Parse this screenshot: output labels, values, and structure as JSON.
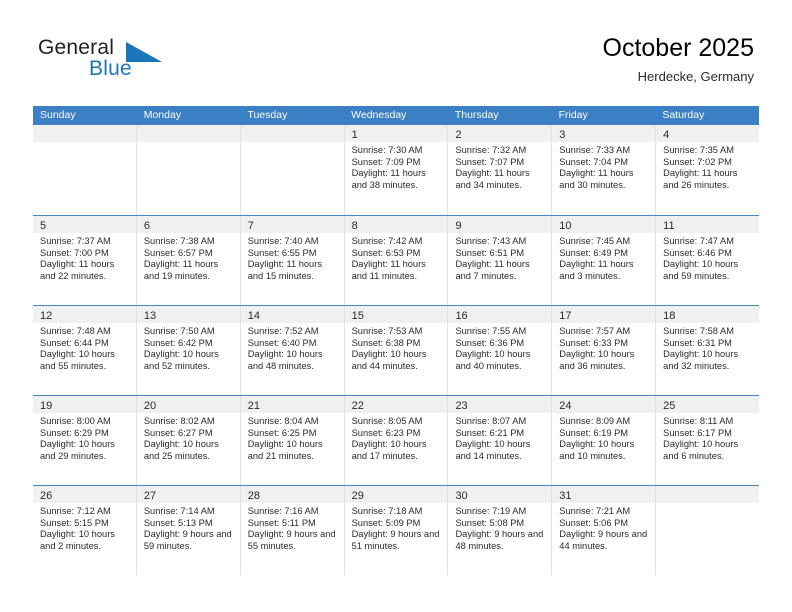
{
  "brand": {
    "word_general": "General",
    "word_blue": "Blue",
    "accent_color": "#1b75bb"
  },
  "header": {
    "title": "October 2025",
    "subtitle": "Herdecke, Germany",
    "header_bg_color": "#3b7fc4"
  },
  "weekdays": [
    "Sunday",
    "Monday",
    "Tuesday",
    "Wednesday",
    "Thursday",
    "Friday",
    "Saturday"
  ],
  "labels": {
    "sunrise_prefix": "Sunrise:",
    "sunset_prefix": "Sunset:",
    "daylight_prefix": "Daylight:"
  },
  "weeks": [
    [
      {
        "day": ""
      },
      {
        "day": ""
      },
      {
        "day": ""
      },
      {
        "day": "1",
        "sunrise": "Sunrise: 7:30 AM",
        "sunset": "Sunset: 7:09 PM",
        "daylight": "Daylight: 11 hours and 38 minutes."
      },
      {
        "day": "2",
        "sunrise": "Sunrise: 7:32 AM",
        "sunset": "Sunset: 7:07 PM",
        "daylight": "Daylight: 11 hours and 34 minutes."
      },
      {
        "day": "3",
        "sunrise": "Sunrise: 7:33 AM",
        "sunset": "Sunset: 7:04 PM",
        "daylight": "Daylight: 11 hours and 30 minutes."
      },
      {
        "day": "4",
        "sunrise": "Sunrise: 7:35 AM",
        "sunset": "Sunset: 7:02 PM",
        "daylight": "Daylight: 11 hours and 26 minutes."
      }
    ],
    [
      {
        "day": "5",
        "sunrise": "Sunrise: 7:37 AM",
        "sunset": "Sunset: 7:00 PM",
        "daylight": "Daylight: 11 hours and 22 minutes."
      },
      {
        "day": "6",
        "sunrise": "Sunrise: 7:38 AM",
        "sunset": "Sunset: 6:57 PM",
        "daylight": "Daylight: 11 hours and 19 minutes."
      },
      {
        "day": "7",
        "sunrise": "Sunrise: 7:40 AM",
        "sunset": "Sunset: 6:55 PM",
        "daylight": "Daylight: 11 hours and 15 minutes."
      },
      {
        "day": "8",
        "sunrise": "Sunrise: 7:42 AM",
        "sunset": "Sunset: 6:53 PM",
        "daylight": "Daylight: 11 hours and 11 minutes."
      },
      {
        "day": "9",
        "sunrise": "Sunrise: 7:43 AM",
        "sunset": "Sunset: 6:51 PM",
        "daylight": "Daylight: 11 hours and 7 minutes."
      },
      {
        "day": "10",
        "sunrise": "Sunrise: 7:45 AM",
        "sunset": "Sunset: 6:49 PM",
        "daylight": "Daylight: 11 hours and 3 minutes."
      },
      {
        "day": "11",
        "sunrise": "Sunrise: 7:47 AM",
        "sunset": "Sunset: 6:46 PM",
        "daylight": "Daylight: 10 hours and 59 minutes."
      }
    ],
    [
      {
        "day": "12",
        "sunrise": "Sunrise: 7:48 AM",
        "sunset": "Sunset: 6:44 PM",
        "daylight": "Daylight: 10 hours and 55 minutes."
      },
      {
        "day": "13",
        "sunrise": "Sunrise: 7:50 AM",
        "sunset": "Sunset: 6:42 PM",
        "daylight": "Daylight: 10 hours and 52 minutes."
      },
      {
        "day": "14",
        "sunrise": "Sunrise: 7:52 AM",
        "sunset": "Sunset: 6:40 PM",
        "daylight": "Daylight: 10 hours and 48 minutes."
      },
      {
        "day": "15",
        "sunrise": "Sunrise: 7:53 AM",
        "sunset": "Sunset: 6:38 PM",
        "daylight": "Daylight: 10 hours and 44 minutes."
      },
      {
        "day": "16",
        "sunrise": "Sunrise: 7:55 AM",
        "sunset": "Sunset: 6:36 PM",
        "daylight": "Daylight: 10 hours and 40 minutes."
      },
      {
        "day": "17",
        "sunrise": "Sunrise: 7:57 AM",
        "sunset": "Sunset: 6:33 PM",
        "daylight": "Daylight: 10 hours and 36 minutes."
      },
      {
        "day": "18",
        "sunrise": "Sunrise: 7:58 AM",
        "sunset": "Sunset: 6:31 PM",
        "daylight": "Daylight: 10 hours and 32 minutes."
      }
    ],
    [
      {
        "day": "19",
        "sunrise": "Sunrise: 8:00 AM",
        "sunset": "Sunset: 6:29 PM",
        "daylight": "Daylight: 10 hours and 29 minutes."
      },
      {
        "day": "20",
        "sunrise": "Sunrise: 8:02 AM",
        "sunset": "Sunset: 6:27 PM",
        "daylight": "Daylight: 10 hours and 25 minutes."
      },
      {
        "day": "21",
        "sunrise": "Sunrise: 8:04 AM",
        "sunset": "Sunset: 6:25 PM",
        "daylight": "Daylight: 10 hours and 21 minutes."
      },
      {
        "day": "22",
        "sunrise": "Sunrise: 8:05 AM",
        "sunset": "Sunset: 6:23 PM",
        "daylight": "Daylight: 10 hours and 17 minutes."
      },
      {
        "day": "23",
        "sunrise": "Sunrise: 8:07 AM",
        "sunset": "Sunset: 6:21 PM",
        "daylight": "Daylight: 10 hours and 14 minutes."
      },
      {
        "day": "24",
        "sunrise": "Sunrise: 8:09 AM",
        "sunset": "Sunset: 6:19 PM",
        "daylight": "Daylight: 10 hours and 10 minutes."
      },
      {
        "day": "25",
        "sunrise": "Sunrise: 8:11 AM",
        "sunset": "Sunset: 6:17 PM",
        "daylight": "Daylight: 10 hours and 6 minutes."
      }
    ],
    [
      {
        "day": "26",
        "sunrise": "Sunrise: 7:12 AM",
        "sunset": "Sunset: 5:15 PM",
        "daylight": "Daylight: 10 hours and 2 minutes."
      },
      {
        "day": "27",
        "sunrise": "Sunrise: 7:14 AM",
        "sunset": "Sunset: 5:13 PM",
        "daylight": "Daylight: 9 hours and 59 minutes."
      },
      {
        "day": "28",
        "sunrise": "Sunrise: 7:16 AM",
        "sunset": "Sunset: 5:11 PM",
        "daylight": "Daylight: 9 hours and 55 minutes."
      },
      {
        "day": "29",
        "sunrise": "Sunrise: 7:18 AM",
        "sunset": "Sunset: 5:09 PM",
        "daylight": "Daylight: 9 hours and 51 minutes."
      },
      {
        "day": "30",
        "sunrise": "Sunrise: 7:19 AM",
        "sunset": "Sunset: 5:08 PM",
        "daylight": "Daylight: 9 hours and 48 minutes."
      },
      {
        "day": "31",
        "sunrise": "Sunrise: 7:21 AM",
        "sunset": "Sunset: 5:06 PM",
        "daylight": "Daylight: 9 hours and 44 minutes."
      },
      {
        "day": ""
      }
    ]
  ]
}
